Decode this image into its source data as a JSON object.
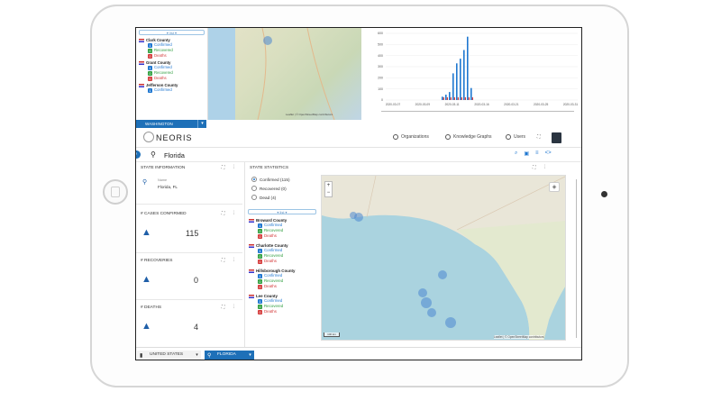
{
  "top": {
    "filter_label": "▾ list ▾",
    "counties": [
      {
        "name": "Clark County",
        "confirmed": "Confirmed",
        "recovered": "Recovered",
        "deaths": "Deaths"
      },
      {
        "name": "Grant County",
        "confirmed": "Confirmed",
        "recovered": "Recovered",
        "deaths": "Deaths"
      },
      {
        "name": "Jefferson County",
        "confirmed": "Confirmed",
        "recovered": "Recovered",
        "deaths": "Deaths"
      }
    ],
    "tab_label": "WASHINGTON",
    "chart_dates": [
      "2020-03-07",
      "2020-03-09",
      "2020-03-11",
      "2020-03-16",
      "2020-03-21",
      "2020-03-25",
      "2020-03-31"
    ],
    "chart_yticks": [
      "0",
      "100",
      "200",
      "300",
      "400",
      "500",
      "600"
    ],
    "map_attrib": "Leaflet | © OpenStreetMap contributors"
  },
  "header": {
    "logo": "NEORIS",
    "nav": [
      {
        "label": "Organizations",
        "icon": "org-icon"
      },
      {
        "label": "Knowledge Graphs",
        "icon": "graph-icon"
      },
      {
        "label": "Users",
        "icon": "users-icon"
      }
    ]
  },
  "location": {
    "name": "Florida"
  },
  "cards": {
    "state_info": {
      "title": "STATE INFORMATION",
      "field_label": "Name",
      "field_value": "Florida, FL"
    },
    "cases": {
      "title": "# CASES CONFIRMED",
      "value": "115"
    },
    "recoveries": {
      "title": "# RECOVERIES",
      "value": "0"
    },
    "deaths": {
      "title": "# DEATHS",
      "value": "4"
    }
  },
  "stats": {
    "title": "STATE STATISTICS",
    "options": [
      "Confirmed (115)",
      "Recovered (0)",
      "Dead (4)"
    ],
    "filter_label": "▾ list ▾",
    "counties": [
      {
        "name": "Broward County",
        "confirmed": "Confirmed",
        "recovered": "Recovered",
        "deaths": "Deaths"
      },
      {
        "name": "Charlotte County",
        "confirmed": "Confirmed",
        "recovered": "Recovered",
        "deaths": "Deaths"
      },
      {
        "name": "Hillsborough County",
        "confirmed": "Confirmed",
        "recovered": "Recovered",
        "deaths": "Deaths"
      },
      {
        "name": "Lee County",
        "confirmed": "Confirmed",
        "recovered": "Recovered",
        "deaths": "Deaths"
      }
    ],
    "map_attrib": "Leaflet | © OpenStreetMap contributors",
    "map_scale": "100 km"
  },
  "bottom_tabs": [
    {
      "label": "UNITED STATES"
    },
    {
      "label": "FLORIDA"
    }
  ],
  "colors": {
    "primary": "#1e70b8",
    "confirmed": "#1f77d0",
    "recovered": "#2e9e3e",
    "deaths": "#d43a3a"
  }
}
